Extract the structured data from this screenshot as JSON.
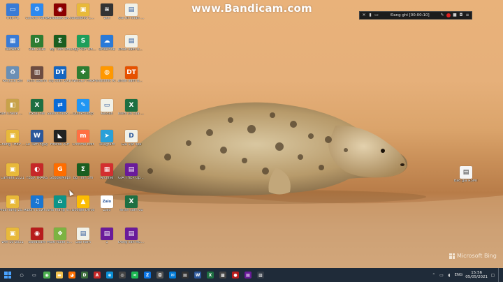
{
  "watermark": "www.Bandicam.com",
  "recorder": {
    "status": "Đang ghi [00:00:10]",
    "icons": [
      "close-icon",
      "pause-icon",
      "refresh-icon",
      "folder-icon",
      "draw-icon",
      "record-icon",
      "camera-icon",
      "menu-icon"
    ]
  },
  "bing_label": "Microsoft Bing",
  "desktop_icons": [
    {
      "label": "This PC",
      "icon": "computer-icon",
      "color": "#3a7bd5",
      "glyph": "▭"
    },
    {
      "label": "Control Panel",
      "icon": "control-panel-icon",
      "color": "#2d89ef",
      "glyph": "⚙"
    },
    {
      "label": "Autodesk Sketchbook",
      "icon": "sketchbook-icon",
      "color": "#8b0000",
      "glyph": "◉"
    },
    {
      "label": "Panasonic Camera",
      "icon": "folder-icon",
      "color": "#e8b93a",
      "glyph": "▣"
    },
    {
      "label": "Wifi",
      "icon": "wifi-icon",
      "color": "#333333",
      "glyph": "≋"
    },
    {
      "label": "Gửi tin nhắn Zalo",
      "icon": "document-icon",
      "color": "#f1f1e8",
      "glyph": "▤"
    },
    {
      "label": "Network",
      "icon": "network-icon",
      "color": "#3a7bd5",
      "glyph": "▦"
    },
    {
      "label": "Viet 2014",
      "icon": "dwg-icon",
      "color": "#2e7d32",
      "glyph": "D"
    },
    {
      "label": "Bộ Tính Sm",
      "icon": "sigma-icon",
      "color": "#1b5e20",
      "glyph": "Σ"
    },
    {
      "label": "Chạy PDF Online",
      "icon": "pdf-icon",
      "color": "#1e9e5a",
      "glyph": "S"
    },
    {
      "label": "OneDrive",
      "icon": "onedrive-icon",
      "color": "#2a7ad8",
      "glyph": "☁"
    },
    {
      "label": "Nhan sam ưu phòng nha",
      "icon": "document-icon",
      "color": "#f1f1e8",
      "glyph": "▤"
    },
    {
      "label": "Recycle Bin",
      "icon": "recycle-bin-icon",
      "color": "#6a8fb5",
      "glyph": "♻"
    },
    {
      "label": "Kinh doanh",
      "icon": "excel-icon",
      "color": "#6d4c41",
      "glyph": "▥"
    },
    {
      "label": "Dự toán GXD",
      "icon": "dt-icon",
      "color": "#1565c0",
      "glyph": "DT"
    },
    {
      "label": "WinSCP Filex",
      "icon": "winscp-icon",
      "color": "#2e7d32",
      "glyph": "✚"
    },
    {
      "label": "Panasonic Ki Nam",
      "icon": "panasonic-icon",
      "color": "#ff9800",
      "glyph": "◍"
    },
    {
      "label": "Nhan sam ưu phòng nha",
      "icon": "dt-icon",
      "color": "#e65100",
      "glyph": "DT"
    },
    {
      "label": "Bản Check mình",
      "icon": "user-folder-icon",
      "color": "#c8a24a",
      "glyph": "◧"
    },
    {
      "label": "Excel file",
      "icon": "excel-icon",
      "color": "#1d6f42",
      "glyph": "X"
    },
    {
      "label": "Sales Check Kế Hoạch",
      "icon": "teamviewer-icon",
      "color": "#0a6bd6",
      "glyph": "⇄"
    },
    {
      "label": "QuickFilezip",
      "icon": "quickfile-icon",
      "color": "#2196f3",
      "glyph": "✎"
    },
    {
      "label": "Ketoan",
      "icon": "shortcut-icon",
      "color": "#f1f1e8",
      "glyph": "▭"
    },
    {
      "label": "Kiểm sổ của Tám",
      "icon": "excel-icon",
      "color": "#1d6f42",
      "glyph": "X"
    },
    {
      "label": "Chứng THEP GT DA CU",
      "icon": "folder-icon",
      "color": "#e8b93a",
      "glyph": "▣"
    },
    {
      "label": "Lê Tâm ngày",
      "icon": "word-icon",
      "color": "#2b579a",
      "glyph": "W"
    },
    {
      "label": "Firefox PDF",
      "icon": "firefox-icon",
      "color": "#222222",
      "glyph": "◣"
    },
    {
      "label": "Chrome Edit",
      "icon": "chrome-icon",
      "color": "#ff7043",
      "glyph": "m"
    },
    {
      "label": "Telegram",
      "icon": "telegram-icon",
      "color": "#2aa0d8",
      "glyph": "➤"
    },
    {
      "label": "Giá Vật liệu",
      "icon": "dwg-icon",
      "color": "#f1f1e8",
      "glyph": "D"
    },
    {
      "label": "Camera 2021",
      "icon": "folder-icon",
      "color": "#e8b93a",
      "glyph": "▣"
    },
    {
      "label": "FBSV TRANS",
      "icon": "fbsv-icon",
      "color": "#c62828",
      "glyph": "◐"
    },
    {
      "label": "GoogleMaps",
      "icon": "orange-g-icon",
      "color": "#ff6d00",
      "glyph": "G"
    },
    {
      "label": "Bộ Tính Sm",
      "icon": "sigma-icon",
      "color": "#1b5e20",
      "glyph": "Σ"
    },
    {
      "label": "Archive",
      "icon": "archive-icon",
      "color": "#d32f2f",
      "glyph": "▦"
    },
    {
      "label": "GIÁ THÉP Update",
      "icon": "winrar-icon",
      "color": "#6a1b9a",
      "glyph": "▤"
    },
    {
      "label": "Mua hàng 2021",
      "icon": "folder-icon",
      "color": "#e8b93a",
      "glyph": "▣"
    },
    {
      "label": "Album Download",
      "icon": "music-icon",
      "color": "#1976d2",
      "glyph": "♫"
    },
    {
      "label": "Nhà mạng Vinh",
      "icon": "location-icon",
      "color": "#0d9488",
      "glyph": "⌂"
    },
    {
      "label": "Google Drive",
      "icon": "drive-icon",
      "color": "#fbbc04",
      "glyph": "▲"
    },
    {
      "label": "Zalo",
      "icon": "zalo-icon",
      "color": "#ffffff",
      "glyph": "Zalo"
    },
    {
      "label": "Nhan sam ưu",
      "icon": "excel-icon",
      "color": "#1d6f42",
      "glyph": "X"
    },
    {
      "label": "Win 10 2021",
      "icon": "folder-icon",
      "color": "#e8b93a",
      "glyph": "▣"
    },
    {
      "label": "Bandicam",
      "icon": "bandicam-icon",
      "color": "#b71c1c",
      "glyph": "◉"
    },
    {
      "label": "Multi Ruler Station Brand",
      "icon": "multi-icon",
      "color": "#7cb342",
      "glyph": "❖"
    },
    {
      "label": "Lắp năm",
      "icon": "document-icon",
      "color": "#f1f1e8",
      "glyph": "▤"
    },
    {
      "label": "1",
      "icon": "winrar-icon",
      "color": "#6a1b9a",
      "glyph": "▤"
    },
    {
      "label": "Đăng sản RGMT",
      "icon": "winrar-icon",
      "color": "#6a1b9a",
      "glyph": "▤"
    },
    {
      "label": "Báo giá RSMT",
      "icon": "text-file-icon",
      "color": "#f5f5f5",
      "glyph": "▤"
    }
  ],
  "taskbar": {
    "apps": [
      {
        "icon": "search-icon",
        "color": "#1f2b39",
        "glyph": "○"
      },
      {
        "icon": "task-view-icon",
        "color": "#1f2b39",
        "glyph": "▭"
      },
      {
        "icon": "chrome-icon",
        "color": "#4caf50",
        "glyph": "◉"
      },
      {
        "icon": "file-explorer-icon",
        "color": "#f2c14e",
        "glyph": "▬"
      },
      {
        "icon": "firefox-icon",
        "color": "#ff6f00",
        "glyph": "◕"
      },
      {
        "icon": "dwg-icon",
        "color": "#3c6e3c",
        "glyph": "D"
      },
      {
        "icon": "autocad-icon",
        "color": "#c62828",
        "glyph": "A"
      },
      {
        "icon": "edge-icon",
        "color": "#0b8fd6",
        "glyph": "e"
      },
      {
        "icon": "media-icon",
        "color": "#444444",
        "glyph": "◎"
      },
      {
        "icon": "spotify-icon",
        "color": "#1db954",
        "glyph": "≈"
      },
      {
        "icon": "zalo-icon",
        "color": "#0b74e5",
        "glyph": "Z"
      },
      {
        "icon": "camera-icon",
        "color": "#555555",
        "glyph": "◘"
      },
      {
        "icon": "mail-icon",
        "color": "#0078d4",
        "glyph": "✉"
      },
      {
        "icon": "store-icon",
        "color": "#333333",
        "glyph": "▤"
      },
      {
        "icon": "word-icon",
        "color": "#2b579a",
        "glyph": "W"
      },
      {
        "icon": "excel-icon",
        "color": "#1d6f42",
        "glyph": "X"
      },
      {
        "icon": "teams-icon",
        "color": "#444444",
        "glyph": "▩"
      },
      {
        "icon": "bandicam-icon",
        "color": "#b71c1c",
        "glyph": "●"
      },
      {
        "icon": "rar-icon",
        "color": "#6a1b9a",
        "glyph": "▤"
      },
      {
        "icon": "photos-icon",
        "color": "#333b46",
        "glyph": "▨"
      }
    ],
    "language": "ENG",
    "time": "15:56",
    "date": "05/05/2021"
  }
}
